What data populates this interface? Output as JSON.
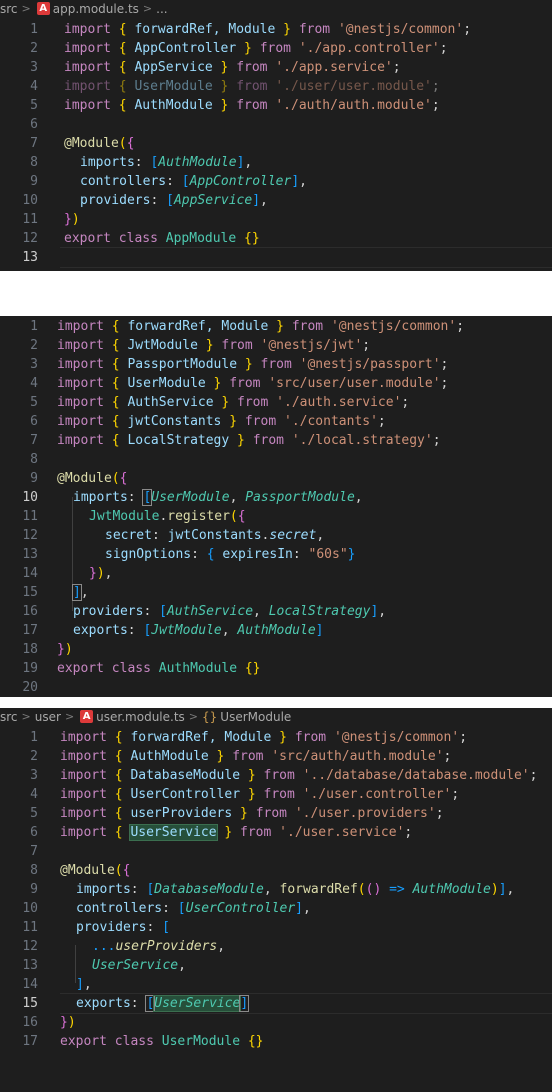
{
  "panels": [
    {
      "breadcrumb": [
        "src",
        "app.module.ts",
        "..."
      ],
      "active_line": 13,
      "lines": [
        "1",
        "2",
        "3",
        "4",
        "5",
        "6",
        "7",
        "8",
        "9",
        "10",
        "11",
        "12",
        "13"
      ],
      "code": {
        "l1": [
          "import ",
          "{ ",
          "forwardRef, Module ",
          "} ",
          "from ",
          "'@nestjs/common'",
          ";"
        ],
        "l2": [
          "import ",
          "{ ",
          "AppController ",
          "} ",
          "from ",
          "'./app.controller'",
          ";"
        ],
        "l3": [
          "import ",
          "{ ",
          "AppService ",
          "} ",
          "from ",
          "'./app.service'",
          ";"
        ],
        "l4": [
          "import ",
          "{ ",
          "UserModule ",
          "} ",
          "from ",
          "'./user/user.module'",
          ";"
        ],
        "l5": [
          "import ",
          "{ ",
          "AuthModule ",
          "} ",
          "from ",
          "'./auth/auth.module'",
          ";"
        ],
        "l7": [
          "@Module",
          "(",
          "{"
        ],
        "l8": [
          "imports",
          ": ",
          "[",
          "AuthModule",
          "]",
          ","
        ],
        "l9": [
          "controllers",
          ": ",
          "[",
          "AppController",
          "]",
          ","
        ],
        "l10": [
          "providers",
          ": ",
          "[",
          "AppService",
          "]",
          ","
        ],
        "l11": [
          "}",
          ")"
        ],
        "l12": [
          "export ",
          "class ",
          "AppModule ",
          "{}"
        ]
      }
    },
    {
      "active_line": 10,
      "lines": [
        "1",
        "2",
        "3",
        "4",
        "5",
        "6",
        "7",
        "8",
        "9",
        "10",
        "11",
        "12",
        "13",
        "14",
        "15",
        "16",
        "17",
        "18",
        "19",
        "20"
      ],
      "code": {
        "l1": [
          "import ",
          "{ ",
          "forwardRef, Module ",
          "} ",
          "from ",
          "'@nestjs/common'",
          ";"
        ],
        "l2": [
          "import ",
          "{ ",
          "JwtModule ",
          "} ",
          "from ",
          "'@nestjs/jwt'",
          ";"
        ],
        "l3": [
          "import ",
          "{ ",
          "PassportModule ",
          "} ",
          "from ",
          "'@nestjs/passport'",
          ";"
        ],
        "l4": [
          "import ",
          "{ ",
          "UserModule ",
          "} ",
          "from ",
          "'src/user/user.module'",
          ";"
        ],
        "l5": [
          "import ",
          "{ ",
          "AuthService ",
          "} ",
          "from ",
          "'./auth.service'",
          ";"
        ],
        "l6": [
          "import ",
          "{ ",
          "jwtConstants ",
          "} ",
          "from ",
          "'./contants'",
          ";"
        ],
        "l7": [
          "import ",
          "{ ",
          "LocalStrategy ",
          "} ",
          "from ",
          "'./local.strategy'",
          ";"
        ],
        "l9": [
          "@Module",
          "(",
          "{"
        ],
        "l10": [
          "imports",
          ": ",
          "[",
          "UserModule",
          ", ",
          "PassportModule",
          ","
        ],
        "l11": [
          "JwtModule",
          ".",
          "register",
          "(",
          "{"
        ],
        "l12": [
          "secret",
          ": ",
          "jwtConstants",
          ".",
          "secret",
          ","
        ],
        "l13": [
          "signOptions",
          ": ",
          "{ ",
          "expiresIn",
          ": ",
          "\"60s\"",
          "}"
        ],
        "l14": [
          "}",
          ")",
          ","
        ],
        "l15": [
          "]",
          ","
        ],
        "l16": [
          "providers",
          ": ",
          "[",
          "AuthService",
          ", ",
          "LocalStrategy",
          "]",
          ","
        ],
        "l17": [
          "exports",
          ": ",
          "[",
          "JwtModule",
          ", ",
          "AuthModule",
          "]"
        ],
        "l18": [
          "}",
          ")"
        ],
        "l19": [
          "export ",
          "class ",
          "AuthModule ",
          "{}"
        ]
      }
    },
    {
      "breadcrumb": [
        "src",
        "user",
        "user.module.ts",
        "UserModule"
      ],
      "active_line": 15,
      "lines": [
        "1",
        "2",
        "3",
        "4",
        "5",
        "6",
        "7",
        "8",
        "9",
        "10",
        "11",
        "12",
        "13",
        "14",
        "15",
        "16",
        "17"
      ],
      "code": {
        "l1": [
          "import ",
          "{ ",
          "forwardRef, Module ",
          "} ",
          "from ",
          "'@nestjs/common'",
          ";"
        ],
        "l2": [
          "import ",
          "{ ",
          "AuthModule ",
          "} ",
          "from ",
          "'src/auth/auth.module'",
          ";"
        ],
        "l3": [
          "import ",
          "{ ",
          "DatabaseModule ",
          "} ",
          "from ",
          "'../database/database.module'",
          ";"
        ],
        "l4": [
          "import ",
          "{ ",
          "UserController ",
          "} ",
          "from ",
          "'./user.controller'",
          ";"
        ],
        "l5": [
          "import ",
          "{ ",
          "userProviders ",
          "} ",
          "from ",
          "'./user.providers'",
          ";"
        ],
        "l6": [
          "import ",
          "{ ",
          "UserService",
          " } ",
          "from ",
          "'./user.service'",
          ";"
        ],
        "l8": [
          "@Module",
          "(",
          "{"
        ],
        "l9": [
          "imports",
          ": ",
          "[",
          "DatabaseModule",
          ", ",
          "forwardRef",
          "(",
          "() ",
          "=> ",
          "AuthModule",
          ")",
          "]",
          ","
        ],
        "l10": [
          "controllers",
          ": ",
          "[",
          "UserController",
          "]",
          ","
        ],
        "l11": [
          "providers",
          ": ",
          "["
        ],
        "l12": [
          "...",
          "userProviders",
          ","
        ],
        "l13": [
          "UserService",
          ","
        ],
        "l14": [
          "]",
          ","
        ],
        "l15": [
          "exports",
          ": ",
          "[",
          "UserService",
          "]"
        ],
        "l16": [
          "}",
          ")"
        ],
        "l17": [
          "export ",
          "class ",
          "UserModule ",
          "{}"
        ]
      }
    }
  ]
}
